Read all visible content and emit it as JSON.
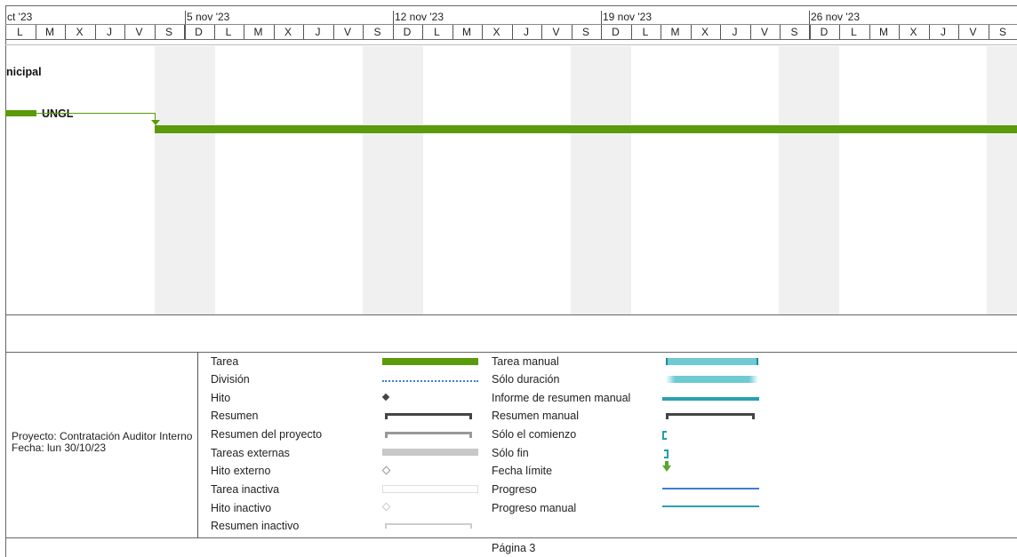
{
  "timescale": {
    "weeks": [
      "ct '23",
      "5 nov '23",
      "12 nov '23",
      "19 nov '23",
      "26 nov '23"
    ],
    "days": [
      "L",
      "M",
      "X",
      "J",
      "V",
      "S",
      "D",
      "L",
      "M",
      "X",
      "J",
      "V",
      "S",
      "D",
      "L",
      "M",
      "X",
      "J",
      "V",
      "S",
      "D",
      "L",
      "M",
      "X",
      "J",
      "V",
      "S",
      "D",
      "L",
      "M",
      "X",
      "J",
      "V",
      "S"
    ]
  },
  "tasks": {
    "summary_label": "nicipal",
    "task_label": "UNGL"
  },
  "footer": {
    "project": "Proyecto: Contratación Auditor Interno",
    "date": "Fecha: lun 30/10/23",
    "page": "Página 3"
  },
  "legend": {
    "left": [
      "Tarea",
      "División",
      "Hito",
      "Resumen",
      "Resumen del proyecto",
      "Tareas externas",
      "Hito externo",
      "Tarea inactiva",
      "Hito inactivo",
      "Resumen inactivo"
    ],
    "right": [
      "Tarea manual",
      "Sólo duración",
      "Informe de resumen manual",
      "Resumen manual",
      "Sólo el comienzo",
      "Sólo fin",
      "Fecha límite",
      "Progreso",
      "Progreso manual"
    ]
  },
  "colors": {
    "task_green": "#5b9a0a",
    "manual_teal": "#6fcad2",
    "progress_blue": "#3b7fd1",
    "deadline_green": "#5aa82c"
  }
}
